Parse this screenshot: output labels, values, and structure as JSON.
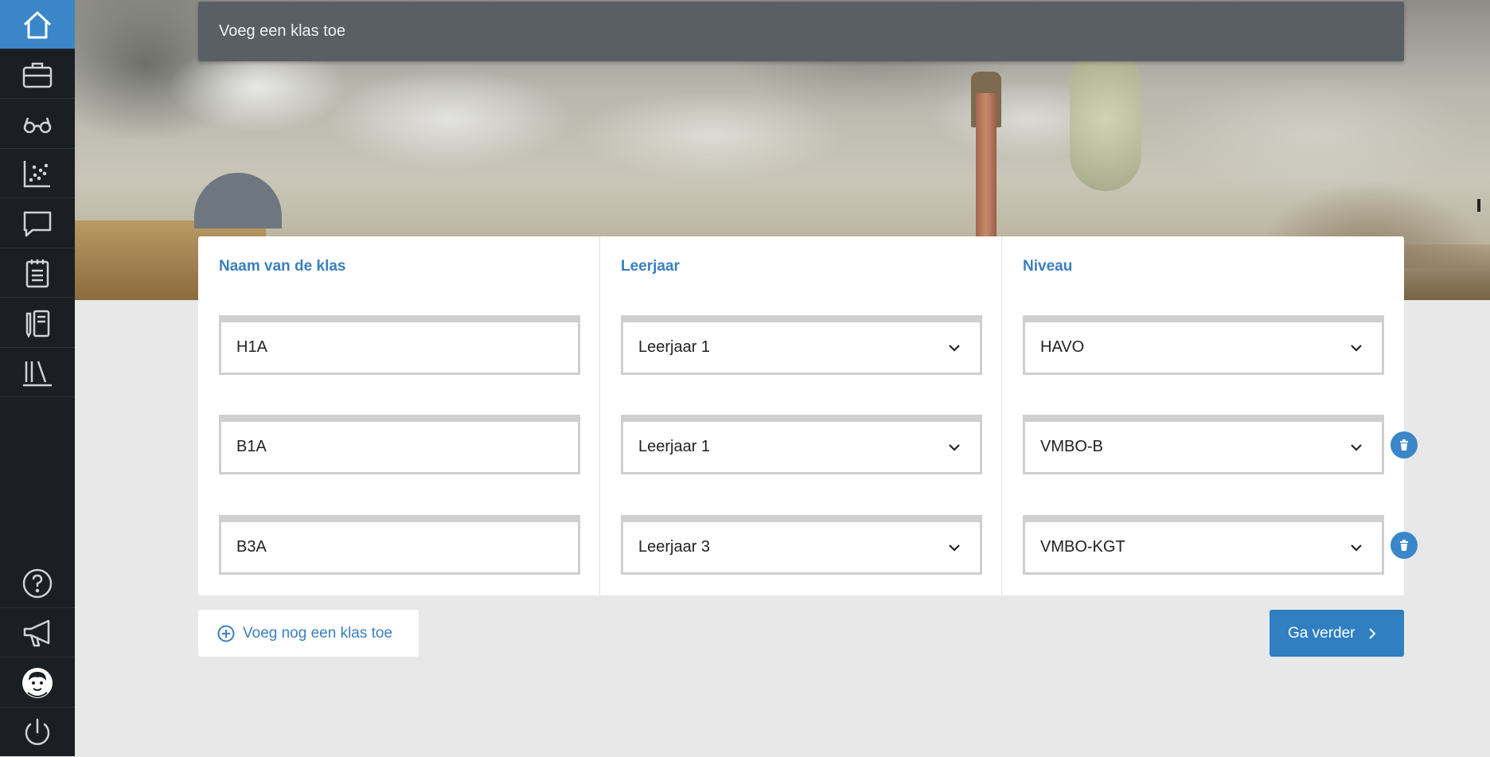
{
  "topbar": {
    "title": "Voeg een klas toe"
  },
  "sidebar": {
    "items": [
      {
        "icon": "home-icon",
        "active": true
      },
      {
        "icon": "briefcase-icon"
      },
      {
        "icon": "glasses-icon"
      },
      {
        "icon": "scatter-chart-icon"
      },
      {
        "icon": "chat-bubble-icon"
      },
      {
        "icon": "clipboard-icon"
      },
      {
        "icon": "notebook-pencil-icon"
      },
      {
        "icon": "library-books-icon"
      },
      {
        "icon": "help-icon"
      },
      {
        "icon": "megaphone-icon"
      },
      {
        "icon": "avatar-icon"
      },
      {
        "icon": "power-icon"
      }
    ]
  },
  "table": {
    "headers": {
      "name": "Naam van de klas",
      "year": "Leerjaar",
      "level": "Niveau"
    },
    "rows": [
      {
        "name": "H1A",
        "year": "Leerjaar 1",
        "level": "HAVO"
      },
      {
        "name": "B1A",
        "year": "Leerjaar 1",
        "level": "VMBO-B"
      },
      {
        "name": "B3A",
        "year": "Leerjaar 3",
        "level": "VMBO-KGT"
      }
    ]
  },
  "actions": {
    "add_class": "Voeg nog een klas toe",
    "continue": "Ga verder"
  },
  "colors": {
    "accent": "#3a86c8",
    "sidebar": "#1b1f24",
    "topbar": "#5a5f66",
    "background": "#e8e8e8"
  }
}
